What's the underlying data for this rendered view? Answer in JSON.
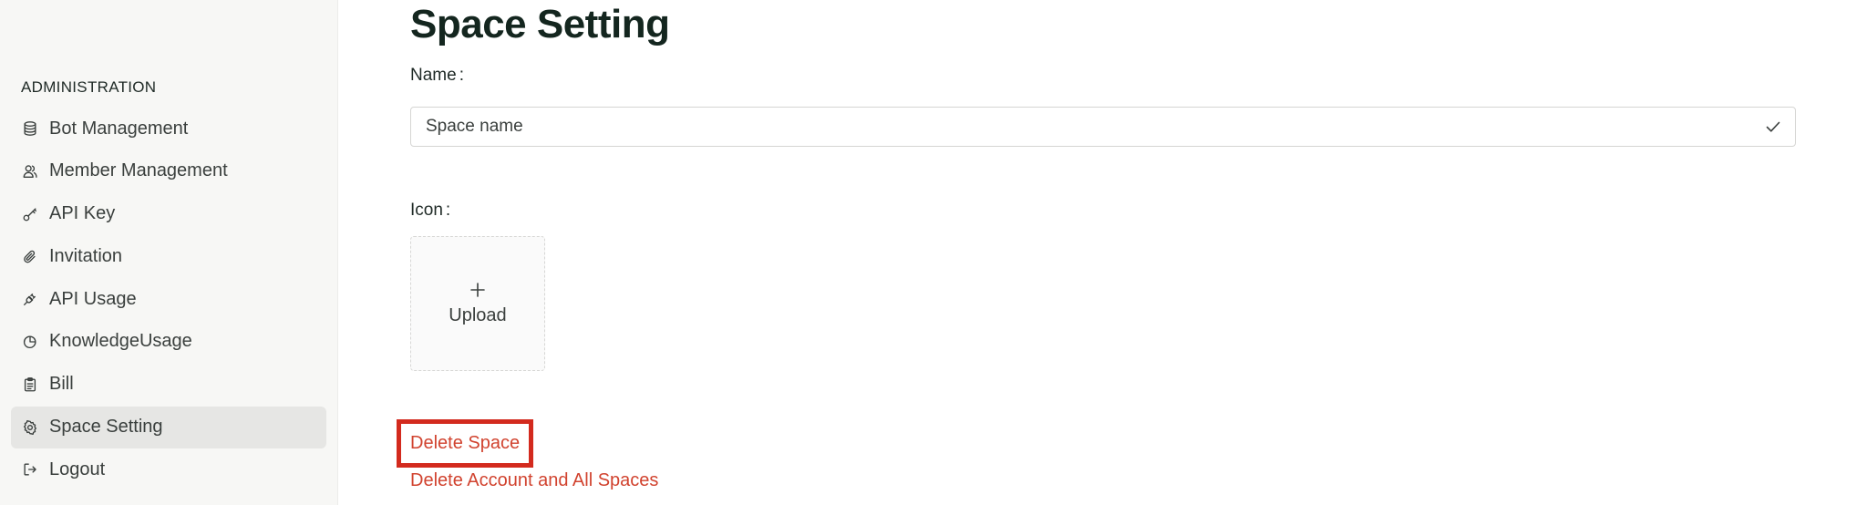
{
  "sidebar": {
    "section_label": "ADMINISTRATION",
    "items": [
      {
        "label": "Bot Management",
        "icon": "database-icon"
      },
      {
        "label": "Member Management",
        "icon": "users-icon"
      },
      {
        "label": "API Key",
        "icon": "key-icon"
      },
      {
        "label": "Invitation",
        "icon": "paperclip-icon"
      },
      {
        "label": "API Usage",
        "icon": "plug-icon"
      },
      {
        "label": "KnowledgeUsage",
        "icon": "chart-circle-icon"
      },
      {
        "label": "Bill",
        "icon": "clipboard-icon"
      },
      {
        "label": "Space Setting",
        "icon": "gear-icon",
        "active": true
      },
      {
        "label": "Logout",
        "icon": "logout-icon"
      }
    ]
  },
  "main": {
    "title": "Space Setting",
    "name_label": "Name",
    "name_colon": ":",
    "name_value": "Space name",
    "icon_label": "Icon",
    "icon_colon": ":",
    "upload_label": "Upload",
    "delete_space": "Delete Space",
    "delete_account": "Delete Account and All Spaces"
  },
  "colors": {
    "danger": "#d1432f",
    "highlight": "#d32a1e",
    "sidebar_bg": "#f7f7f5",
    "active_item_bg": "#e6e6e4"
  }
}
